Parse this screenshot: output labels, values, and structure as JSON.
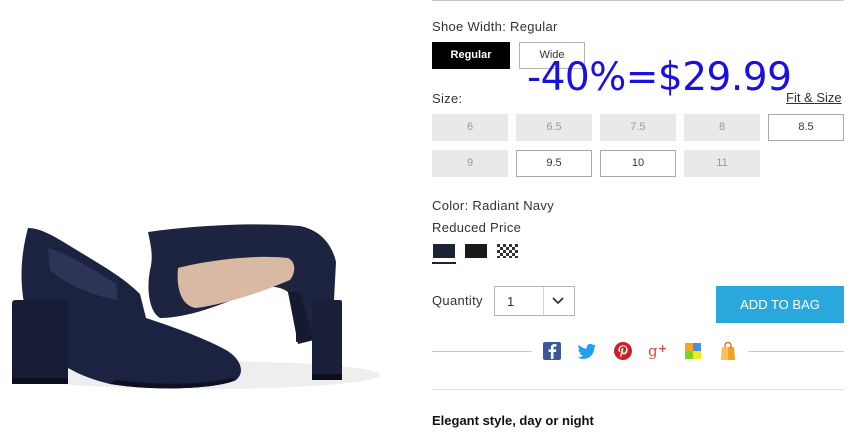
{
  "width": {
    "label": "Shoe Width: Regular",
    "options": [
      {
        "label": "Regular",
        "selected": true
      },
      {
        "label": "Wide",
        "selected": false
      }
    ]
  },
  "promo": {
    "text": "-40%=$29.99",
    "color": "#1a10e0"
  },
  "size": {
    "label": "Size:",
    "fit_link": "Fit & Size",
    "options": [
      {
        "label": "6",
        "available": false
      },
      {
        "label": "6.5",
        "available": false
      },
      {
        "label": "7.5",
        "available": false
      },
      {
        "label": "8",
        "available": false
      },
      {
        "label": "8.5",
        "available": true
      },
      {
        "label": "9",
        "available": false
      },
      {
        "label": "9.5",
        "available": true
      },
      {
        "label": "10",
        "available": true
      },
      {
        "label": "11",
        "available": false
      }
    ]
  },
  "color": {
    "label": "Color: Radiant Navy",
    "price_note": "Reduced Price",
    "swatches": [
      {
        "name": "Radiant Navy",
        "hex": "#1b2335",
        "selected": true
      },
      {
        "name": "Black",
        "hex": "#1a1a1a",
        "selected": false
      },
      {
        "name": "Houndstooth",
        "hex": "#555555",
        "selected": false
      }
    ]
  },
  "quantity": {
    "label": "Quantity",
    "value": "1"
  },
  "cart": {
    "button_label": "ADD TO BAG",
    "color": "#2aa8dc"
  },
  "share": {
    "icons": [
      "facebook-icon",
      "twitter-icon",
      "pinterest-icon",
      "google-plus-icon",
      "sharing-widget-icon",
      "shopping-bag-icon"
    ]
  },
  "description": {
    "headline": "Elegant style, day or night"
  },
  "product_image": {
    "alt": "Navy leather block-heel pumps"
  }
}
